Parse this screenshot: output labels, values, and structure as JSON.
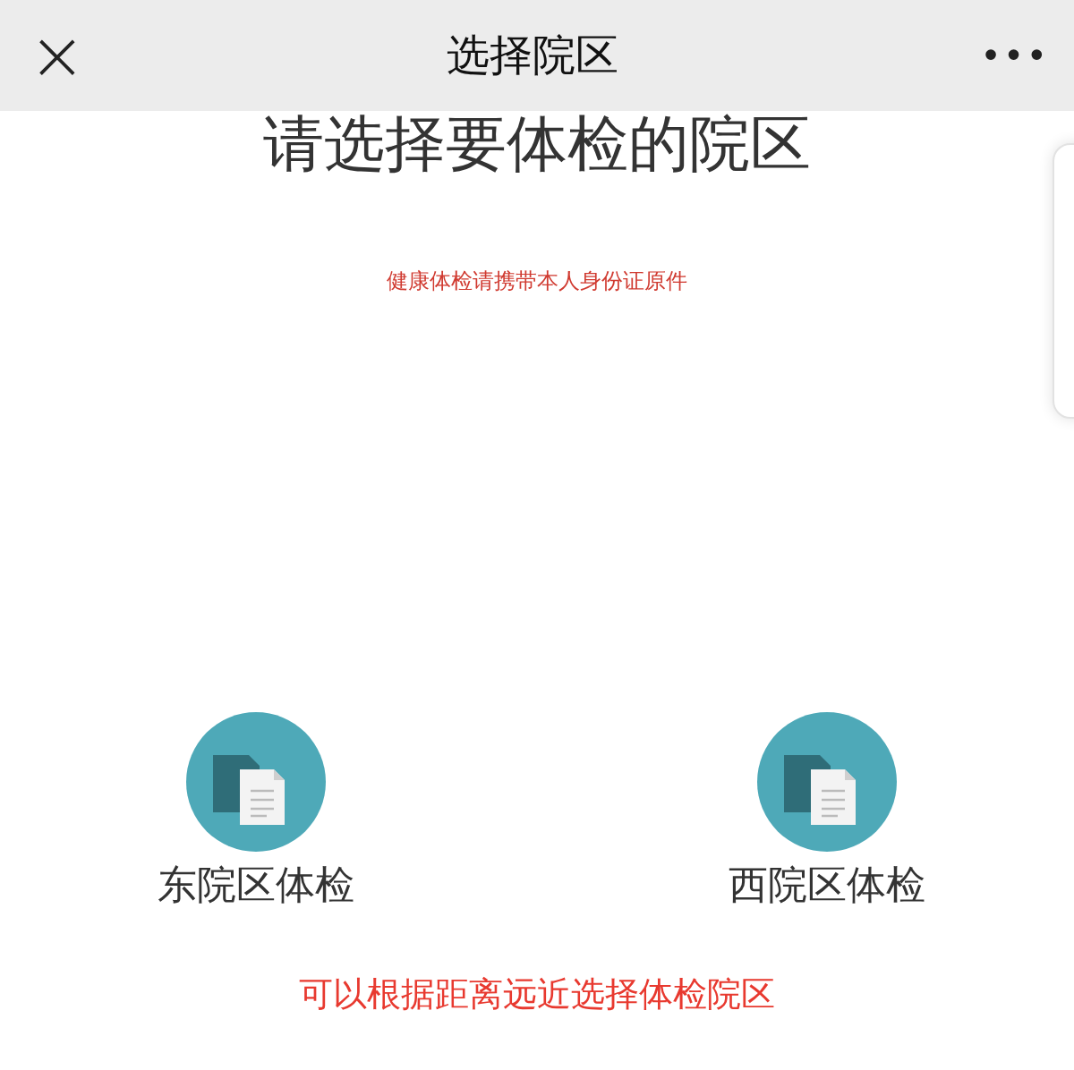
{
  "nav_bar": {
    "close_icon": "×",
    "title": "选择院区",
    "more_icon": "•••"
  },
  "heading": "请选择要体检的院区",
  "notice": "健康体检请携带本人身份证原件",
  "campuses": [
    {
      "label": "东院区体检"
    },
    {
      "label": "西院区体检"
    }
  ],
  "hint": "可以根据距离远近选择体检院区"
}
